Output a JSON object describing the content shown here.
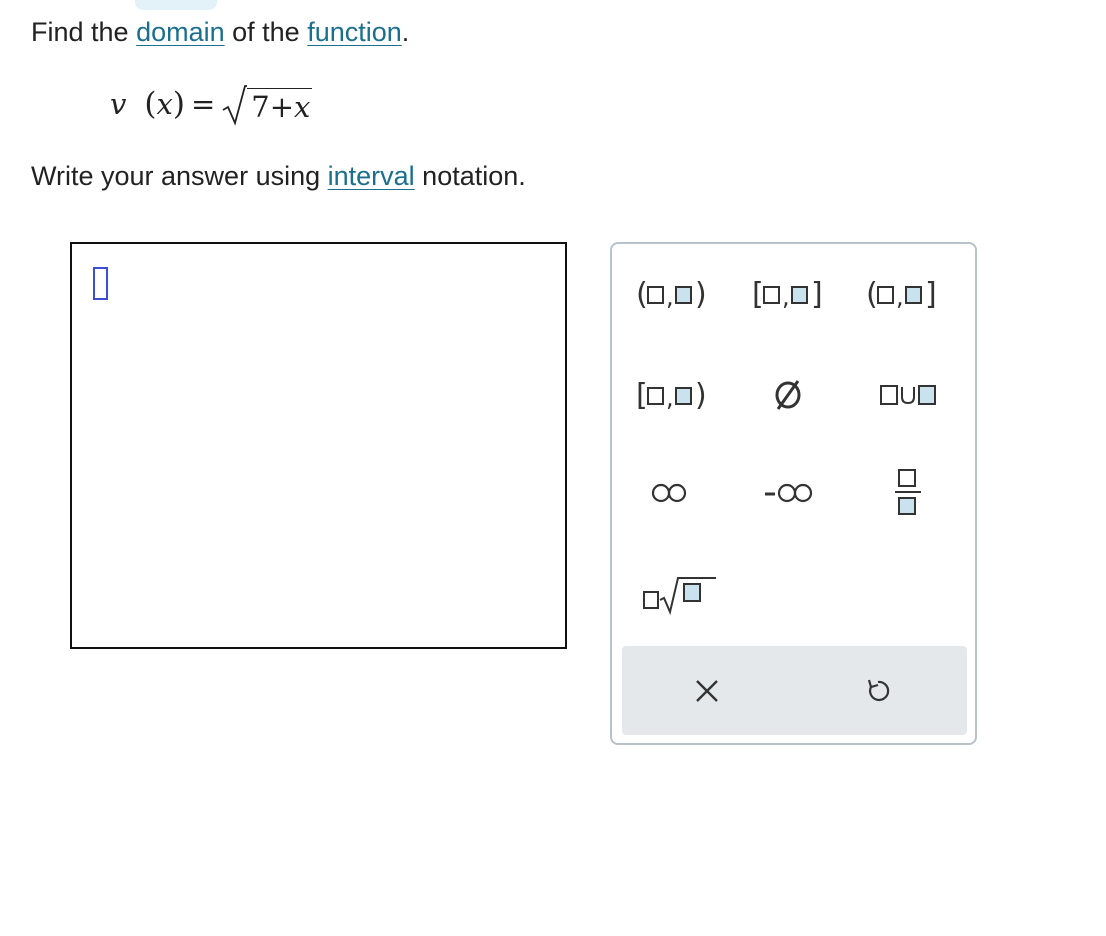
{
  "prompt": {
    "line1_pre": "Find the ",
    "link_domain": "domain",
    "line1_mid": " of the ",
    "link_function": "function",
    "line1_post": ".",
    "line2_pre": "Write your answer using ",
    "link_interval": "interval",
    "line2_post": " notation."
  },
  "equation": {
    "fn": "v",
    "open": "(",
    "arg": "x",
    "close": ")",
    "equals": "=",
    "radicand_num": "7",
    "plus": "+",
    "radicand_var": "x"
  },
  "answer": {
    "value": ""
  },
  "palette": {
    "buttons": [
      "open-interval",
      "closed-interval",
      "left-open-right-closed-interval",
      "left-closed-right-open-interval",
      "empty-set",
      "union",
      "infinity",
      "negative-infinity",
      "fraction",
      "nth-root"
    ],
    "footer": [
      "clear",
      "undo"
    ]
  },
  "colors": {
    "link": "#1b6f8e",
    "cursor": "#3a4fd4",
    "slot_fill": "#c9e2ee",
    "palette_border": "#b7c2ca",
    "footer_bg": "#e4e8eb"
  }
}
